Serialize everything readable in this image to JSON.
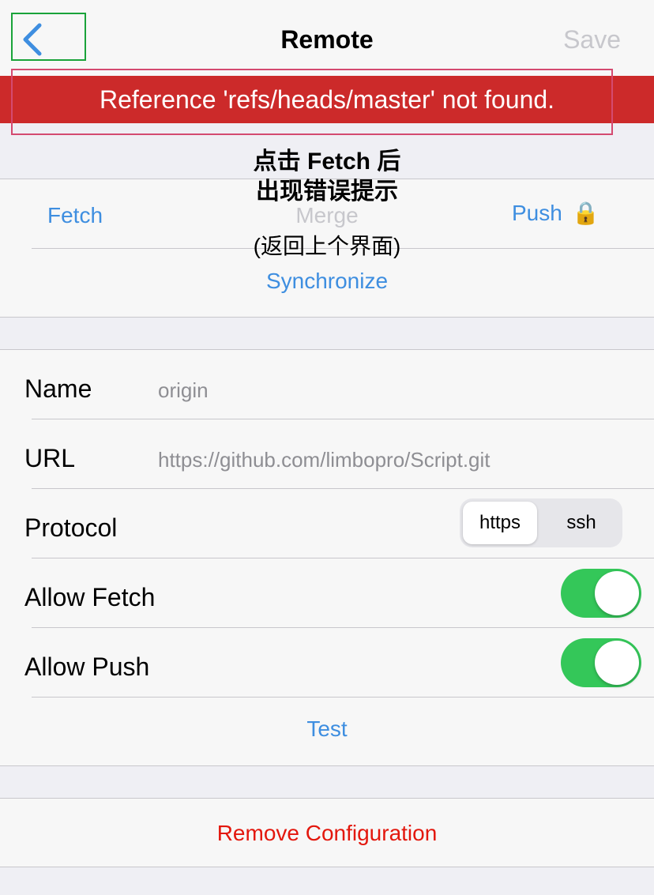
{
  "nav": {
    "title": "Remote",
    "save_label": "Save"
  },
  "error": {
    "message": "Reference 'refs/heads/master' not found."
  },
  "annotation": {
    "line1": "点击 Fetch 后",
    "line2": "出现错误提示",
    "line3": "(返回上个界面)"
  },
  "actions": {
    "fetch": "Fetch",
    "merge": "Merge",
    "push": "Push",
    "lock_glyph": "🔒",
    "synchronize": "Synchronize"
  },
  "form": {
    "name_label": "Name",
    "name_value": "origin",
    "url_label": "URL",
    "url_value": "https://github.com/limbopro/Script.git",
    "protocol_label": "Protocol",
    "protocol_options": [
      "https",
      "ssh"
    ],
    "protocol_selected": "https",
    "allow_fetch_label": "Allow Fetch",
    "allow_fetch": true,
    "allow_push_label": "Allow Push",
    "allow_push": true,
    "test_label": "Test"
  },
  "remove": {
    "label": "Remove Configuration"
  },
  "colors": {
    "accent": "#3e8ee0",
    "banner": "#cc2a2a",
    "toggle_on": "#34c759",
    "danger": "#e3170d"
  },
  "icons": {
    "back": "chevron-left-icon",
    "lock": "lock-icon"
  }
}
